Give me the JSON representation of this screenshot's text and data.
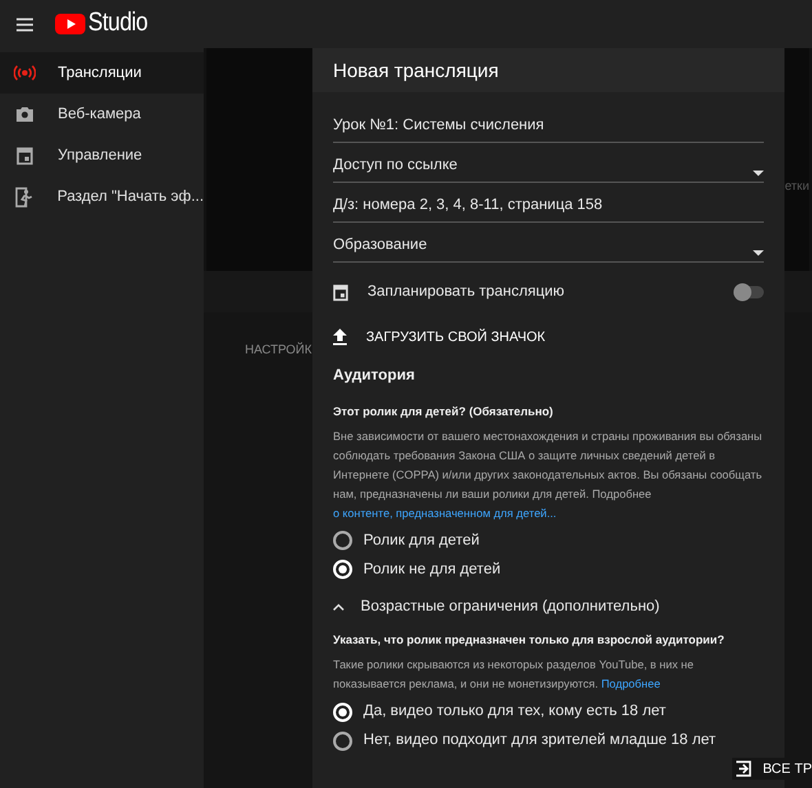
{
  "header": {
    "logo_text": "Studio"
  },
  "sidebar": {
    "items": [
      {
        "label": "Трансляции",
        "selected": true,
        "kind": "live"
      },
      {
        "label": "Веб-камера",
        "selected": false,
        "kind": "camera"
      },
      {
        "label": "Управление",
        "selected": false,
        "kind": "calendar"
      },
      {
        "label": "Раздел \"Начать эф...",
        "selected": false,
        "kind": "exit"
      }
    ]
  },
  "background": {
    "side_text": "етки",
    "tab_label": "НАСТРОЙК",
    "bottom_button": "ВСЕ ТР"
  },
  "dialog": {
    "title": "Новая трансляция",
    "fields": [
      {
        "kind": "text",
        "value": "Урок №1: Системы счисления"
      },
      {
        "kind": "select",
        "value": "Доступ по ссылке"
      },
      {
        "kind": "text",
        "value": "Д/з: номера 2, 3, 4, 8-11, страница 158"
      },
      {
        "kind": "select",
        "value": "Образование"
      }
    ],
    "schedule": {
      "label": "Запланировать трансляцию",
      "on": false
    },
    "upload_label": "ЗАГРУЗИТЬ СВОЙ ЗНАЧОК",
    "audience": {
      "title": "Аудитория",
      "question": "Этот ролик для детей? (Обязательно)",
      "text": "Вне зависимости от вашего местонахождения и страны проживания вы обязаны соблюдать требования Закона США о защите личных сведений детей в Интернете (COPPA) и/или других законодательных актов. Вы обязаны сообщать нам, предназначены ли ваши ролики для детей. Подробнее ",
      "link": "о контенте, предназначенном для детей...",
      "options": [
        {
          "label": "Ролик для детей",
          "selected": false
        },
        {
          "label": "Ролик не для детей",
          "selected": true
        }
      ]
    },
    "age": {
      "title": "Возрастные ограничения (дополнительно)",
      "expanded": true,
      "question": "Указать, что ролик предназначен только для взрослой аудитории?",
      "text": "Такие ролики скрываются из некоторых разделов YouTube, в них не показывается реклама, и они не монетизируются. ",
      "link": "Подробнее",
      "options": [
        {
          "label": "Да, видео только для тех, кому есть 18 лет",
          "selected": true
        },
        {
          "label": "Нет, видео подходит для зрителей младше 18 лет",
          "selected": false
        }
      ]
    }
  }
}
